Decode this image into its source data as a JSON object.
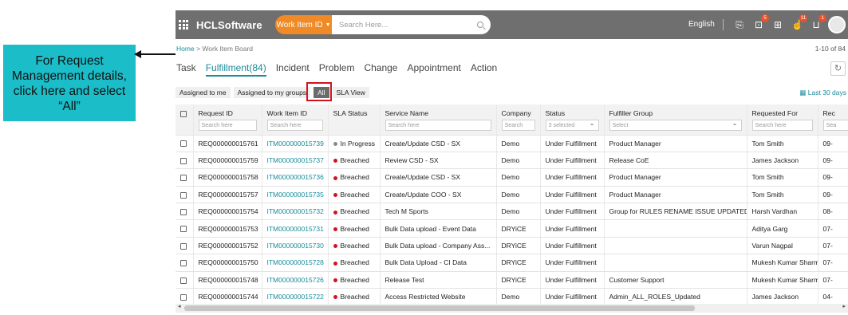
{
  "callout": {
    "text": "For Request Management details, click here and select “All”"
  },
  "topbar": {
    "brand": "HCLSoftware",
    "search_type": "Work Item ID",
    "search_placeholder": "Search Here...",
    "language": "English",
    "badges": {
      "notifications": "5",
      "cart_badge1": "11",
      "cart_badge2": "1"
    }
  },
  "breadcrumb": {
    "home": "Home",
    "separator": ">",
    "current": "Work Item Board"
  },
  "pager": "1-10 of 84",
  "tabs": [
    "Task",
    "Fulfillment(84)",
    "Incident",
    "Problem",
    "Change",
    "Appointment",
    "Action"
  ],
  "filters": [
    "Assigned to me",
    "Assigned to my groups",
    "All",
    "SLA View"
  ],
  "date_range": "Last 30 days",
  "columns": [
    {
      "label": "Request ID",
      "filter": "Search here",
      "dropdown": false
    },
    {
      "label": "Work Item ID",
      "filter": "Search here",
      "dropdown": false
    },
    {
      "label": "SLA Status",
      "filter": "",
      "dropdown": false
    },
    {
      "label": "Service Name",
      "filter": "Search here",
      "dropdown": false
    },
    {
      "label": "Company",
      "filter": "Search",
      "dropdown": false
    },
    {
      "label": "Status",
      "filter": "3 selected",
      "dropdown": true
    },
    {
      "label": "Fulfiller Group",
      "filter": "Select",
      "dropdown": true
    },
    {
      "label": "Requested For",
      "filter": "Search here",
      "dropdown": false
    },
    {
      "label": "Rec",
      "filter": "Sea",
      "dropdown": false
    }
  ],
  "rows": [
    [
      "REQ000000015761",
      "ITM000000015739",
      "In Progress",
      "Create/Update CSD - SX",
      "Demo",
      "Under Fulfillment",
      "Product Manager",
      "Tom Smith",
      "09-"
    ],
    [
      "REQ000000015759",
      "ITM000000015737",
      "Breached",
      "Review CSD - SX",
      "Demo",
      "Under Fulfillment",
      "Release CoE",
      "James Jackson",
      "09-"
    ],
    [
      "REQ000000015758",
      "ITM000000015736",
      "Breached",
      "Create/Update CSD - SX",
      "Demo",
      "Under Fulfillment",
      "Product Manager",
      "Tom Smith",
      "09-"
    ],
    [
      "REQ000000015757",
      "ITM000000015735",
      "Breached",
      "Create/Update COO - SX",
      "Demo",
      "Under Fulfillment",
      "Product Manager",
      "Tom Smith",
      "09-"
    ],
    [
      "REQ000000015754",
      "ITM000000015732",
      "Breached",
      "Tech M Sports",
      "Demo",
      "Under Fulfillment",
      "Group for RULES RENAME ISSUE UPDATED",
      "Harsh Vardhan",
      "08-"
    ],
    [
      "REQ000000015753",
      "ITM000000015731",
      "Breached",
      "Bulk Data upload - Event Data",
      "DRYiCE",
      "Under Fulfillment",
      "",
      "Aditya Garg",
      "07-"
    ],
    [
      "REQ000000015752",
      "ITM000000015730",
      "Breached",
      "Bulk Data upload - Company Ass...",
      "DRYiCE",
      "Under Fulfillment",
      "",
      "Varun Nagpal",
      "07-"
    ],
    [
      "REQ000000015750",
      "ITM000000015728",
      "Breached",
      "Bulk Data Upload - CI Data",
      "DRYiCE",
      "Under Fulfillment",
      "",
      "Mukesh Kumar Sharma",
      "07-"
    ],
    [
      "REQ000000015748",
      "ITM000000015726",
      "Breached",
      "Release Test",
      "DRYiCE",
      "Under Fulfillment",
      "Customer Support",
      "Mukesh Kumar Sharma",
      "07-"
    ],
    [
      "REQ000000015744",
      "ITM000000015722",
      "Breached",
      "Access Restricted Website",
      "Demo",
      "Under Fulfillment",
      "Admin_ALL_ROLES_Updated",
      "James Jackson",
      "04-"
    ]
  ],
  "colors": {
    "accent": "#1a8b9b",
    "orange": "#ef8a26",
    "breached": "#d2121f",
    "in_progress": "#8a8a8a",
    "callout": "#1bbdc8"
  }
}
